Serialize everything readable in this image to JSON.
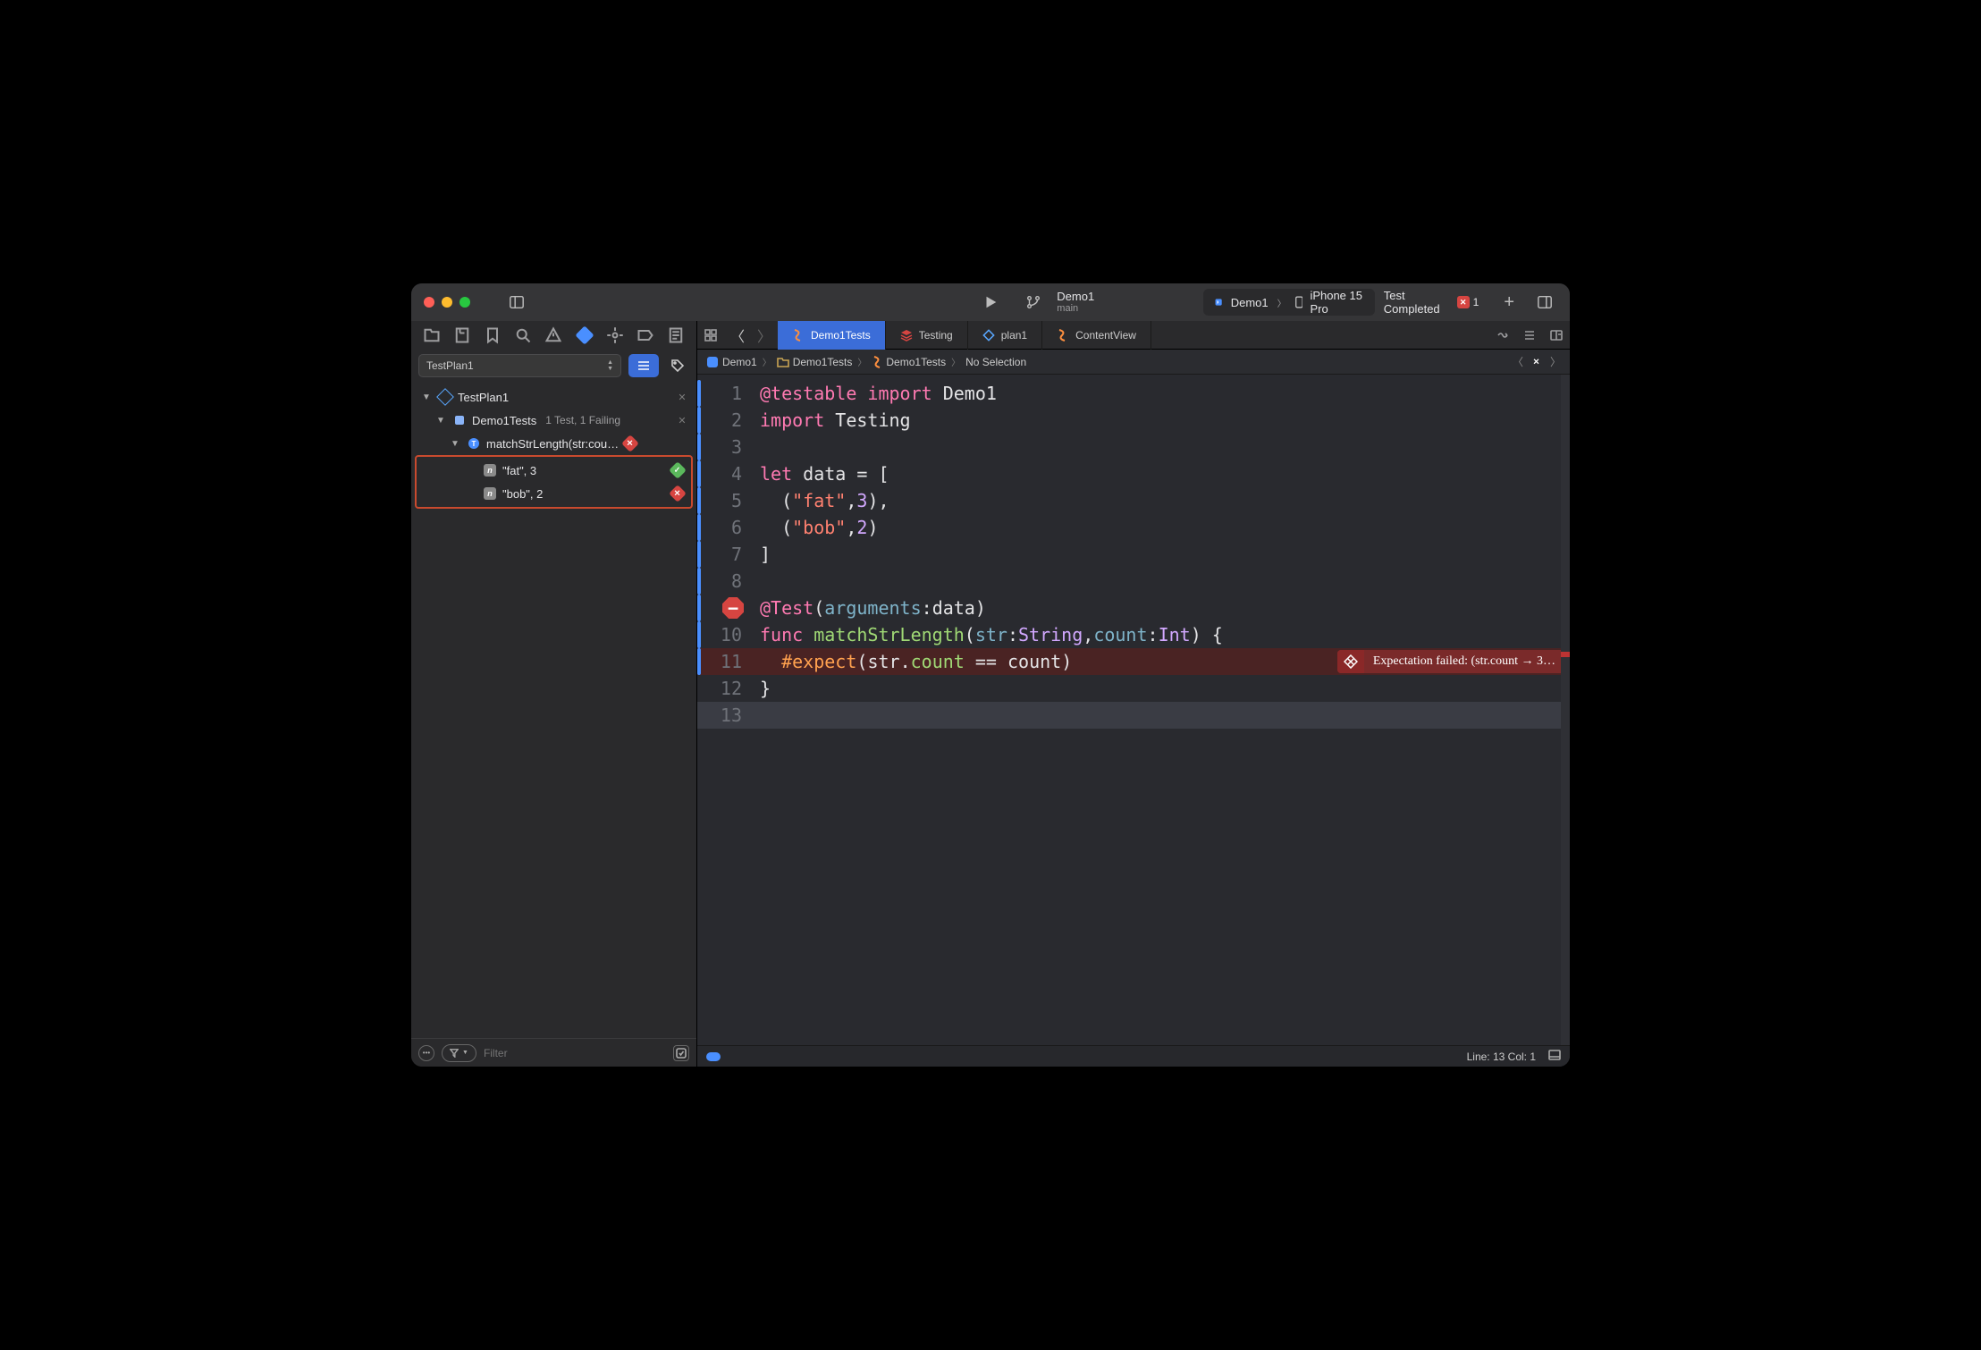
{
  "titlebar": {
    "project": "Demo1",
    "branch": "main",
    "scheme_target": "Demo1",
    "scheme_device": "iPhone 15 Pro",
    "status": "Test Completed",
    "fail_count": "1"
  },
  "sidebar": {
    "dropdown": "TestPlan1",
    "plan": "TestPlan1",
    "suite": "Demo1Tests",
    "suite_meta": "1 Test, 1 Failing",
    "test": "matchStrLength(str:cou…",
    "cases": [
      {
        "label": "\"fat\", 3",
        "status": "pass"
      },
      {
        "label": "\"bob\", 2",
        "status": "fail"
      }
    ],
    "filter_placeholder": "Filter"
  },
  "tabs": [
    {
      "label": "Demo1Tests",
      "kind": "swift",
      "active": true
    },
    {
      "label": "Testing",
      "kind": "stack",
      "active": false
    },
    {
      "label": "plan1",
      "kind": "plan",
      "active": false
    },
    {
      "label": "ContentView",
      "kind": "swift",
      "active": false
    }
  ],
  "jumpbar": {
    "p1": "Demo1",
    "p2": "Demo1Tests",
    "p3": "Demo1Tests",
    "p4": "No Selection"
  },
  "code": {
    "lines": [
      {
        "n": 1,
        "html": "<span class='ann'>@testable</span> <span class='kw'>import</span> <span class='id'>Demo1</span>",
        "bar": true
      },
      {
        "n": 2,
        "html": "<span class='kw'>import</span> <span class='id'>Testing</span>",
        "bar": true
      },
      {
        "n": 3,
        "html": "",
        "bar": true
      },
      {
        "n": 4,
        "html": "<span class='kw'>let</span> <span class='id'>data</span> <span class='op'>= [</span>",
        "bar": true
      },
      {
        "n": 5,
        "html": "  <span class='op'>(</span><span class='str'>\"fat\"</span><span class='op'>,</span><span class='num'>3</span><span class='op'>),</span>",
        "bar": true
      },
      {
        "n": 6,
        "html": "  <span class='op'>(</span><span class='str'>\"bob\"</span><span class='op'>,</span><span class='num'>2</span><span class='op'>)</span>",
        "bar": true
      },
      {
        "n": 7,
        "html": "<span class='op'>]</span>",
        "bar": true
      },
      {
        "n": 8,
        "html": "",
        "bar": true
      },
      {
        "n": 9,
        "html": "<span class='ann'>@Test</span><span class='op'>(</span><span class='par'>arguments</span><span class='op'>:</span><span class='id'>data</span><span class='op'>)</span>",
        "bar": true,
        "stop": true
      },
      {
        "n": 10,
        "html": "<span class='kw'>func</span> <span class='fn'>matchStrLength</span><span class='op'>(</span><span class='par'>str</span><span class='op'>:</span><span class='tp'>String</span><span class='op'>,</span><span class='par'>count</span><span class='op'>:</span><span class='tp'>Int</span><span class='op'>) {</span>",
        "bar": true
      },
      {
        "n": 11,
        "html": "  <span class='mac'>#expect</span><span class='op'>(</span><span class='id'>str</span><span class='op'>.</span><span class='prop'>count</span> <span class='op'>==</span> <span class='id'>count</span><span class='op'>)</span>",
        "bar": true,
        "err": true
      },
      {
        "n": 12,
        "html": "<span class='op'>}</span>"
      },
      {
        "n": 13,
        "html": "",
        "cursor": true
      }
    ],
    "inline_error": "Expectation failed: (str.count → 3…"
  },
  "statusbar": {
    "pos": "Line: 13  Col: 1"
  }
}
